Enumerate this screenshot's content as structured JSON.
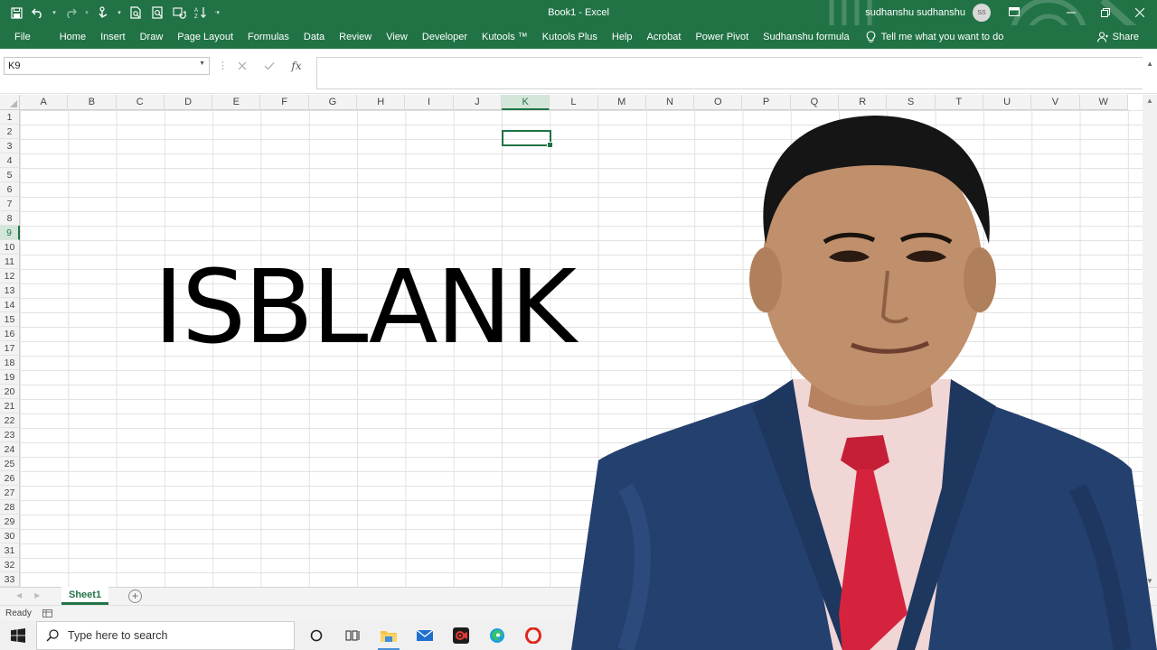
{
  "app": {
    "doc_title": "Book1  -  Excel",
    "user_name": "sudhanshu sudhanshu",
    "user_initials": "SS"
  },
  "ribbon": {
    "tabs": [
      "File",
      "Home",
      "Insert",
      "Draw",
      "Page Layout",
      "Formulas",
      "Data",
      "Review",
      "View",
      "Developer",
      "Kutools ™",
      "Kutools Plus",
      "Help",
      "Acrobat",
      "Power Pivot",
      "Sudhanshu formula"
    ],
    "tell_me": "Tell me what you want to do",
    "share": "Share"
  },
  "formula_bar": {
    "name_box": "K9",
    "fx_label": "fx",
    "formula": ""
  },
  "grid": {
    "columns": [
      "A",
      "B",
      "C",
      "D",
      "E",
      "F",
      "G",
      "H",
      "I",
      "J",
      "K",
      "L",
      "M",
      "N",
      "O",
      "P",
      "Q",
      "R",
      "S",
      "T",
      "U",
      "V",
      "W"
    ],
    "selected_column": "K",
    "rows": [
      "1",
      "2",
      "3",
      "4",
      "5",
      "6",
      "7",
      "8",
      "9",
      "10",
      "11",
      "12",
      "13",
      "14",
      "15",
      "16",
      "17",
      "18",
      "19",
      "20",
      "21",
      "22",
      "23",
      "24",
      "25",
      "26",
      "27",
      "28",
      "29",
      "30",
      "31",
      "32",
      "33"
    ],
    "selected_row": "9",
    "overlay_text": "ISBLANK"
  },
  "sheets": {
    "tabs": [
      "Sheet1"
    ],
    "add_label": "+"
  },
  "status": {
    "text": "Ready"
  },
  "taskbar": {
    "search_placeholder": "Type here to search",
    "accent": "#4a8fd6"
  },
  "colors": {
    "excel_green": "#217346",
    "selection_fill": "#d3e6d9",
    "suit_blue": "#24406e",
    "tie_red": "#d6233d"
  }
}
